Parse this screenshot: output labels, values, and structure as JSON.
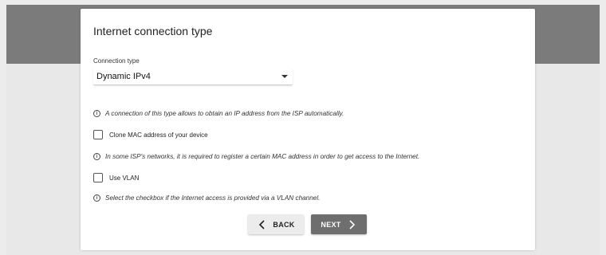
{
  "page": {
    "title": "Internet connection type"
  },
  "connection": {
    "label": "Connection type",
    "selected": "Dynamic IPv4",
    "info": "A connection of this type allows to obtain an IP address from the ISP automatically."
  },
  "clone_mac": {
    "label": "Clone MAC address of your device",
    "checked": false,
    "info": "In some ISP's networks, it is required to register a certain MAC address in order to get access to the Internet."
  },
  "vlan": {
    "label": "Use VLAN",
    "checked": false,
    "info": "Select the checkbox if the Internet access is provided via a VLAN channel."
  },
  "buttons": {
    "back": "BACK",
    "next": "NEXT"
  },
  "icons": {
    "info": "info-icon",
    "back": "chevron-left-icon",
    "next": "chevron-right-icon",
    "dropdown": "caret-down-icon"
  },
  "colors": {
    "header_band": "#7b7b7b",
    "background": "#e8e8e8",
    "next_button": "#6e6e6e",
    "back_button": "#ececec"
  }
}
